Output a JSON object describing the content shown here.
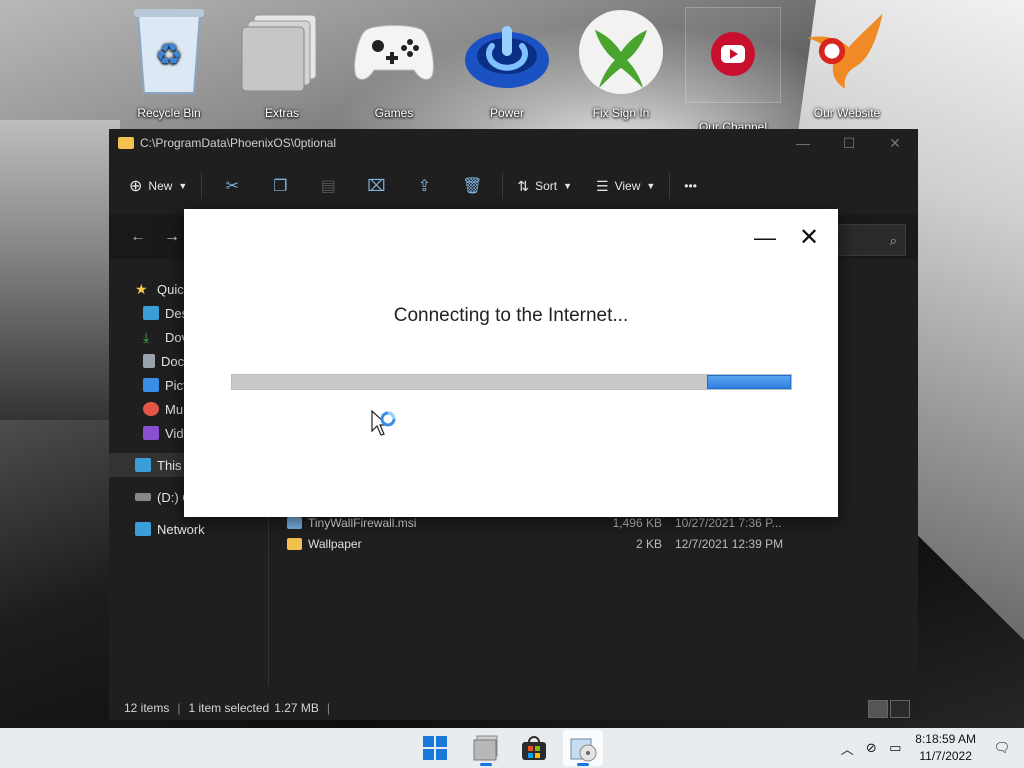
{
  "desktop": {
    "icons": [
      {
        "label": "Recycle Bin"
      },
      {
        "label": "Extras"
      },
      {
        "label": "Games"
      },
      {
        "label": "Power"
      },
      {
        "label": "Fix Sign In"
      },
      {
        "label": "Our Channel"
      },
      {
        "label": "Our Website"
      }
    ]
  },
  "explorer": {
    "title": "C:\\ProgramData\\PhoenixOS\\0ptional",
    "toolbar": {
      "new_label": "New",
      "sort_label": "Sort",
      "view_label": "View",
      "more_label": "•••"
    },
    "nav": {
      "items": [
        {
          "label": "Quic"
        },
        {
          "label": "Des"
        },
        {
          "label": "Dov"
        },
        {
          "label": "Doc"
        },
        {
          "label": "Pict"
        },
        {
          "label": "Mu"
        },
        {
          "label": "Vid"
        },
        {
          "label": "This"
        },
        {
          "label": "(D:) C"
        },
        {
          "label": "Network"
        }
      ]
    },
    "files": [
      {
        "name": "TinyWallFirewall.msi",
        "size": "1,496 KB",
        "date": "10/27/2021 7:36 P..."
      },
      {
        "name": "Wallpaper",
        "size": "2 KB",
        "date": "12/7/2021 12:39 PM"
      }
    ],
    "status": {
      "items": "12 items",
      "selected": "1 item selected",
      "size": "1.27 MB"
    }
  },
  "dialog": {
    "message": "Connecting to the Internet...",
    "progress_start": 0.85,
    "progress_end": 1.0
  },
  "taskbar": {
    "time": "8:18:59 AM",
    "date": "11/7/2022"
  },
  "colors": {
    "accent": "#2f7fe0",
    "explorer_bg": "#1f1f1f",
    "taskbar_bg": "#e8ecef"
  }
}
